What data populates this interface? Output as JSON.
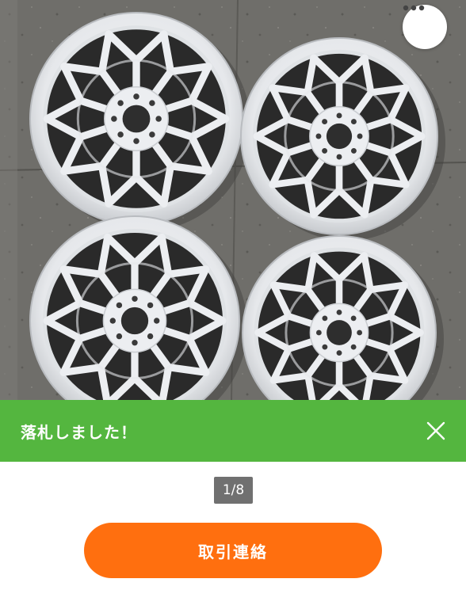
{
  "photo": {
    "image_subject": "four white mesh-style car wheels on concrete"
  },
  "more_button": {
    "icon": "more-horizontal-icon"
  },
  "toast": {
    "message": "落札しました！",
    "close_icon": "close-icon",
    "background_color": "#54b63f"
  },
  "pager": {
    "label": "1/8"
  },
  "contact_button": {
    "label": "取引連絡",
    "background_color": "#ff6f0f"
  }
}
